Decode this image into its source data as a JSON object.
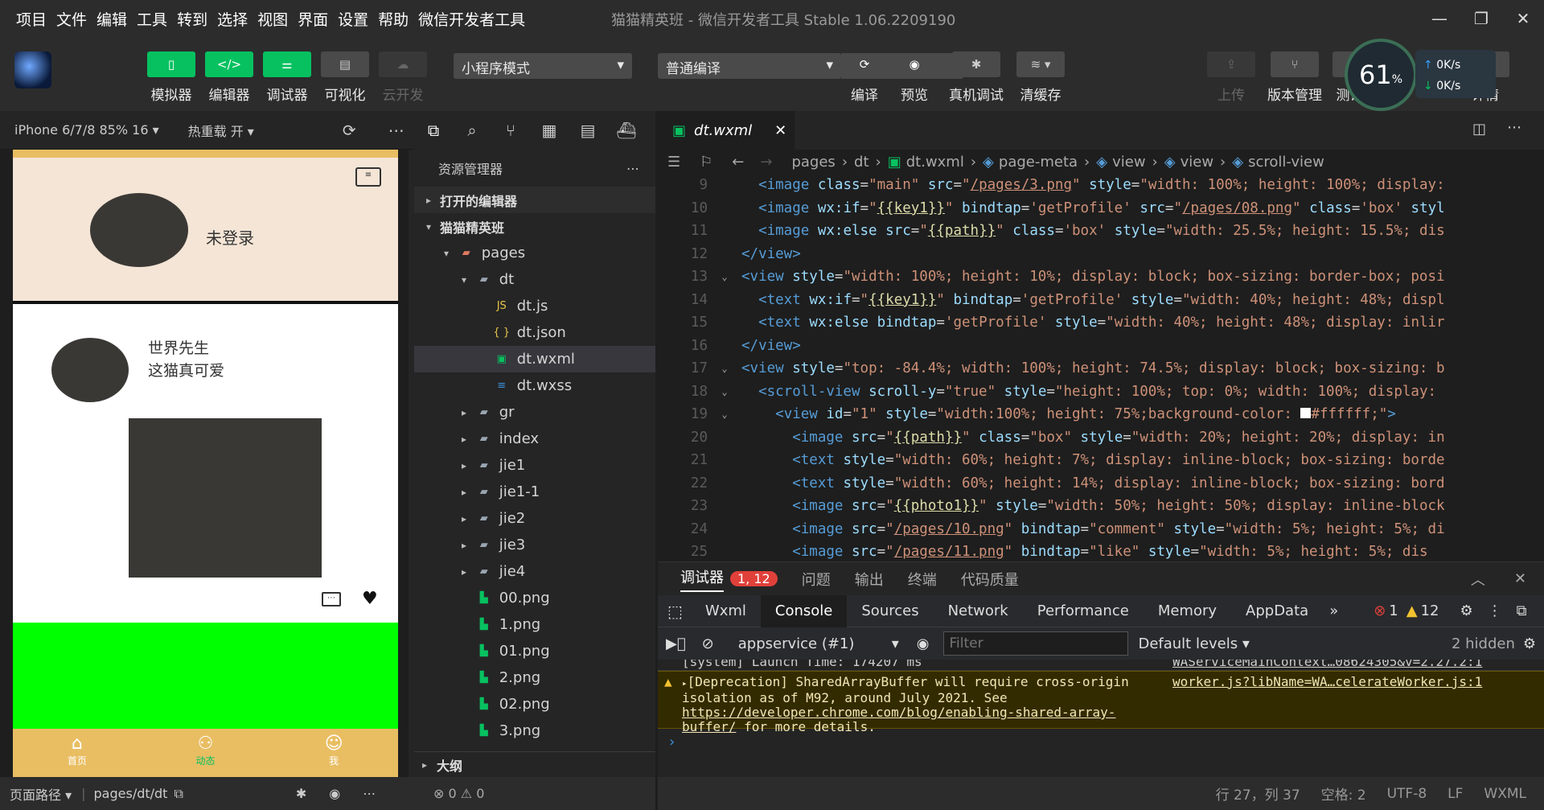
{
  "menu": [
    "项目",
    "文件",
    "编辑",
    "工具",
    "转到",
    "选择",
    "视图",
    "界面",
    "设置",
    "帮助",
    "微信开发者工具"
  ],
  "window_title": "猫猫精英班 - 微信开发者工具 Stable 1.06.2209190",
  "toolbar": {
    "simulator": "模拟器",
    "editor": "编辑器",
    "debugger": "调试器",
    "visual": "可视化",
    "cloud": "云开发",
    "mode": "小程序模式",
    "compile_mode": "普通编译",
    "compile": "编译",
    "preview": "预览",
    "real_debug": "真机调试",
    "clear_cache": "清缓存",
    "upload": "上传",
    "version": "版本管理",
    "test": "测试号",
    "detail": "详情"
  },
  "perf": {
    "percent": "61",
    "unit": "%",
    "up": "0K/s",
    "down": "0K/s"
  },
  "sim": {
    "device": "iPhone 6/7/8 85% 16 ▾",
    "hotreload": "热重载 开 ▾",
    "login": "未登录",
    "user": "世界先生",
    "post": "这猫真可爱",
    "tabs": [
      "首页",
      "动态",
      "我"
    ]
  },
  "sim_status": {
    "path_label": "页面路径 ▾",
    "path": "pages/dt/dt"
  },
  "explorer": {
    "title": "资源管理器",
    "open_editors": "打开的编辑器",
    "project": "猫猫精英班",
    "outline": "大纲",
    "status": "⊗ 0 ⚠ 0",
    "items": [
      {
        "name": "pages",
        "depth": 1,
        "type": "folder-red",
        "arrow": "▾"
      },
      {
        "name": "dt",
        "depth": 2,
        "type": "folder",
        "arrow": "▾"
      },
      {
        "name": "dt.js",
        "depth": 3,
        "type": "js",
        "arrow": ""
      },
      {
        "name": "dt.json",
        "depth": 3,
        "type": "json",
        "arrow": ""
      },
      {
        "name": "dt.wxml",
        "depth": 3,
        "type": "wxml",
        "arrow": "",
        "active": true
      },
      {
        "name": "dt.wxss",
        "depth": 3,
        "type": "wxss",
        "arrow": ""
      },
      {
        "name": "gr",
        "depth": 2,
        "type": "folder",
        "arrow": "▸"
      },
      {
        "name": "index",
        "depth": 2,
        "type": "folder",
        "arrow": "▸"
      },
      {
        "name": "jie1",
        "depth": 2,
        "type": "folder",
        "arrow": "▸"
      },
      {
        "name": "jie1-1",
        "depth": 2,
        "type": "folder",
        "arrow": "▸"
      },
      {
        "name": "jie2",
        "depth": 2,
        "type": "folder",
        "arrow": "▸"
      },
      {
        "name": "jie3",
        "depth": 2,
        "type": "folder",
        "arrow": "▸"
      },
      {
        "name": "jie4",
        "depth": 2,
        "type": "folder",
        "arrow": "▸"
      },
      {
        "name": "00.png",
        "depth": 2,
        "type": "img",
        "arrow": ""
      },
      {
        "name": "1.png",
        "depth": 2,
        "type": "img",
        "arrow": ""
      },
      {
        "name": "01.png",
        "depth": 2,
        "type": "img",
        "arrow": ""
      },
      {
        "name": "2.png",
        "depth": 2,
        "type": "img",
        "arrow": ""
      },
      {
        "name": "02.png",
        "depth": 2,
        "type": "img",
        "arrow": ""
      },
      {
        "name": "3.png",
        "depth": 2,
        "type": "img",
        "arrow": ""
      }
    ]
  },
  "editor": {
    "tab": "dt.wxml",
    "breadcrumb": [
      "pages",
      "dt",
      "dt.wxml",
      "page-meta",
      "view",
      "view",
      "scroll-view"
    ],
    "lines": [
      {
        "n": "9",
        "f": "",
        "h": "  <span class='t'>&lt;image</span> <span class='a'>class</span>=<span class='s'>\"main\"</span> <span class='a'>src</span>=<span class='s'>\"</span><span class='u'>/pages/3.png</span><span class='s'>\"</span> <span class='a'>style</span>=<span class='s'>\"width: 100%; height: 100%; display:</span>"
      },
      {
        "n": "10",
        "f": "",
        "h": "  <span class='t'>&lt;image</span> <span class='a'>wx:if</span>=<span class='s'>\"</span><span class='pl'>{{key1}}</span><span class='s'>\"</span> <span class='a'>bindtap</span>=<span class='s'>'getProfile'</span> <span class='a'>src</span>=<span class='s'>\"</span><span class='u'>/pages/08.png</span><span class='s'>\"</span> <span class='a'>class</span>=<span class='s'>'box'</span> <span class='a'>styl</span>"
      },
      {
        "n": "11",
        "f": "",
        "h": "  <span class='t'>&lt;image</span> <span class='a'>wx:else</span> <span class='a'>src</span>=<span class='s'>\"</span><span class='pl'>{{path}}</span><span class='s'>\"</span> <span class='a'>class</span>=<span class='s'>'box'</span> <span class='a'>style</span>=<span class='s'>\"width: 25.5%; height: 15.5%; dis</span>"
      },
      {
        "n": "12",
        "f": "",
        "h": "<span class='t'>&lt;/view&gt;</span>"
      },
      {
        "n": "13",
        "f": "⌄",
        "h": "<span class='t'>&lt;view</span> <span class='a'>style</span>=<span class='s'>\"width: 100%; height: 10%; display: block; box-sizing: border-box; posi</span>"
      },
      {
        "n": "14",
        "f": "",
        "h": "  <span class='t'>&lt;text</span> <span class='a'>wx:if</span>=<span class='s'>\"</span><span class='pl'>{{key1}}</span><span class='s'>\"</span> <span class='a'>bindtap</span>=<span class='s'>'getProfile'</span> <span class='a'>style</span>=<span class='s'>\"width: 40%; height: 48%; displ</span>"
      },
      {
        "n": "15",
        "f": "",
        "h": "  <span class='t'>&lt;text</span> <span class='a'>wx:else</span> <span class='a'>bindtap</span>=<span class='s'>'getProfile'</span> <span class='a'>style</span>=<span class='s'>\"width: 40%; height: 48%; display: inlir</span>"
      },
      {
        "n": "16",
        "f": "",
        "h": "<span class='t'>&lt;/view&gt;</span>"
      },
      {
        "n": "17",
        "f": "⌄",
        "h": "<span class='t'>&lt;view</span> <span class='a'>style</span>=<span class='s'>\"top: -84.4%; width: 100%; height: 74.5%; display: block; box-sizing: b</span>"
      },
      {
        "n": "18",
        "f": "⌄",
        "h": "  <span class='t'>&lt;scroll-view</span> <span class='a'>scroll-y</span>=<span class='s'>\"true\"</span> <span class='a'>style</span>=<span class='s'>\"height: 100%; top: 0%; width: 100%; display:</span>"
      },
      {
        "n": "19",
        "f": "⌄",
        "h": "    <span class='t'>&lt;view</span> <span class='a'>id</span>=<span class='s'>\"1\"</span> <span class='a'>style</span>=<span class='s'>\"width:100%; height: 75%;background-color: </span><span style='background:#fff;display:inline-block;width:13px;height:13px'></span><span class='s'>#ffffff;\"</span><span class='t'>&gt;</span>"
      },
      {
        "n": "20",
        "f": "",
        "h": "      <span class='t'>&lt;image</span> <span class='a'>src</span>=<span class='s'>\"</span><span class='pl'>{{path}}</span><span class='s'>\"</span> <span class='a'>class</span>=<span class='s'>\"box\"</span> <span class='a'>style</span>=<span class='s'>\"width: 20%; height: 20%; display: in</span>"
      },
      {
        "n": "21",
        "f": "",
        "h": "      <span class='t'>&lt;text</span> <span class='a'>style</span>=<span class='s'>\"width: 60%; height: 7%; display: inline-block; box-sizing: borde</span>"
      },
      {
        "n": "22",
        "f": "",
        "h": "      <span class='t'>&lt;text</span> <span class='a'>style</span>=<span class='s'>\"width: 60%; height: 14%; display: inline-block; box-sizing: bord</span>"
      },
      {
        "n": "23",
        "f": "",
        "h": "      <span class='t'>&lt;image</span> <span class='a'>src</span>=<span class='s'>\"</span><span class='pl'>{{photo1}}</span><span class='s'>\"</span> <span class='a'>style</span>=<span class='s'>\"width: 50%; height: 50%; display: inline-block</span>"
      },
      {
        "n": "24",
        "f": "",
        "h": "      <span class='t'>&lt;image</span> <span class='a'>src</span>=<span class='s'>\"</span><span class='u'>/pages/10.png</span><span class='s'>\"</span> <span class='a'>bindtap</span>=<span class='s'>\"comment\"</span> <span class='a'>style</span>=<span class='s'>\"width: 5%; height: 5%; di</span>"
      },
      {
        "n": "25",
        "f": "",
        "h": "      <span class='t'>&lt;image</span> <span class='a'>src</span>=<span class='s'>\"</span><span class='u'>/pages/11.png</span><span class='s'>\"</span> <span class='a'>bindtap</span>=<span class='s'>\"like\"</span> <span class='a'>style</span>=<span class='s'>\"width: 5%; height: 5%; dis</span>"
      }
    ]
  },
  "debug": {
    "tab_debugger": "调试器",
    "badge": "1, 12",
    "tab_issues": "问题",
    "tab_output": "输出",
    "tab_terminal": "终端",
    "tab_quality": "代码质量",
    "devtabs": [
      "Wxml",
      "Console",
      "Sources",
      "Network",
      "Performance",
      "Memory",
      "AppData"
    ],
    "errors": "1",
    "warnings": "12",
    "context": "appservice (#1)",
    "filter_placeholder": "Filter",
    "levels": "Default levels ▾",
    "hidden": "2 hidden",
    "log_sys": "[system] Launch Time: 174207 ms",
    "log_sys_src": "WAServiceMainContext…08624305&v=2.27.2:1",
    "warn_text": "[Deprecation] SharedArrayBuffer will require cross-origin isolation as of M92, around July 2021. See ",
    "warn_link": "https://developer.chrome.com/blog/enabling-shared-array-buffer/",
    "warn_tail": " for more details.",
    "warn_src": "worker.js?libName=WA…celerateWorker.js:1"
  },
  "status": {
    "pos": "行 27，列 37",
    "space": "空格: 2",
    "enc": "UTF-8",
    "eol": "LF",
    "lang": "WXML"
  }
}
